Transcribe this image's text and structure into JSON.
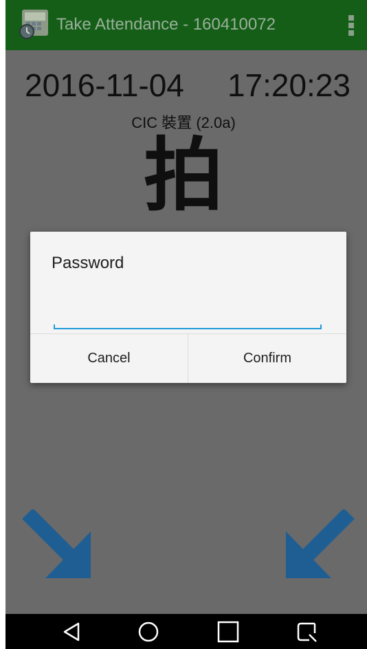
{
  "appbar": {
    "title": "Take Attendance - 160410072",
    "app_icon": "attendance-app-icon",
    "overflow_icon": "more-vert-icon",
    "color": "#155e18"
  },
  "main": {
    "date": "2016-11-04",
    "time": "17:20:23",
    "device_label": "CIC 裝置 (2.0a)",
    "big_character": "拍",
    "arrow_left_icon": "arrow-down-right-icon",
    "arrow_right_icon": "arrow-down-left-icon",
    "arrow_color": "#1f5e93",
    "dim_background": "#6a6a6a"
  },
  "dialog": {
    "title": "Password",
    "password_value": "",
    "cancel_label": "Cancel",
    "confirm_label": "Confirm",
    "accent_color": "#1e9ad8"
  },
  "navbar": {
    "items": [
      "back-icon",
      "home-icon",
      "recents-icon",
      "screenshot-icon"
    ]
  }
}
